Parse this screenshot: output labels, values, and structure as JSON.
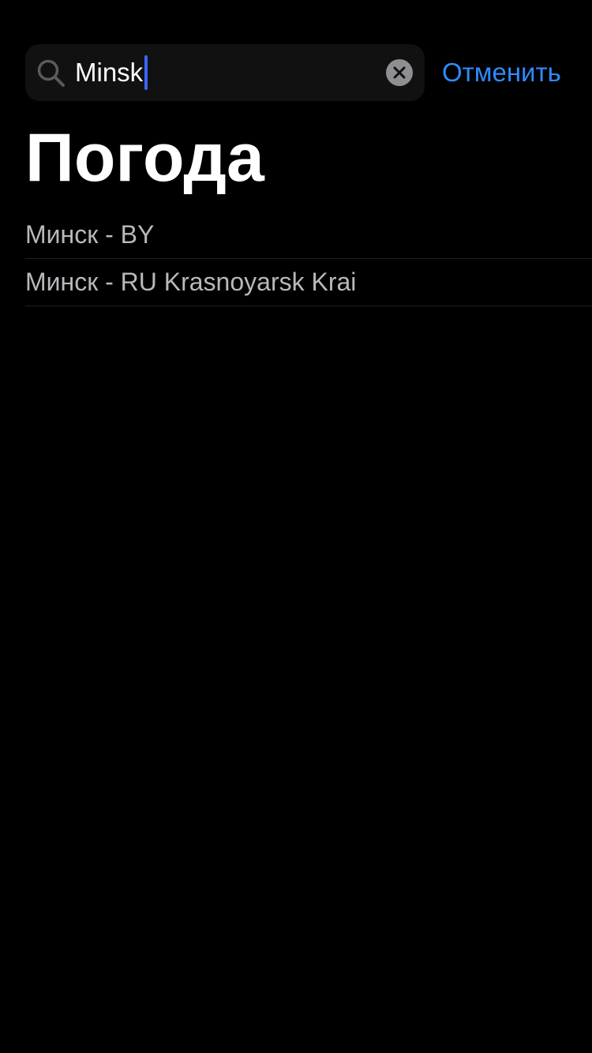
{
  "search": {
    "value": "Minsk",
    "cancel_label": "Отменить"
  },
  "page": {
    "title": "Погода"
  },
  "results": [
    {
      "label": "Минск - BY"
    },
    {
      "label": "Минск - RU Krasnoyarsk Krai"
    }
  ],
  "icons": {
    "search": "search-icon",
    "clear": "clear-icon"
  },
  "colors": {
    "background": "#000000",
    "accent": "#2f8bff",
    "caret": "#3a64ff",
    "result_text": "#b8b8bd"
  }
}
